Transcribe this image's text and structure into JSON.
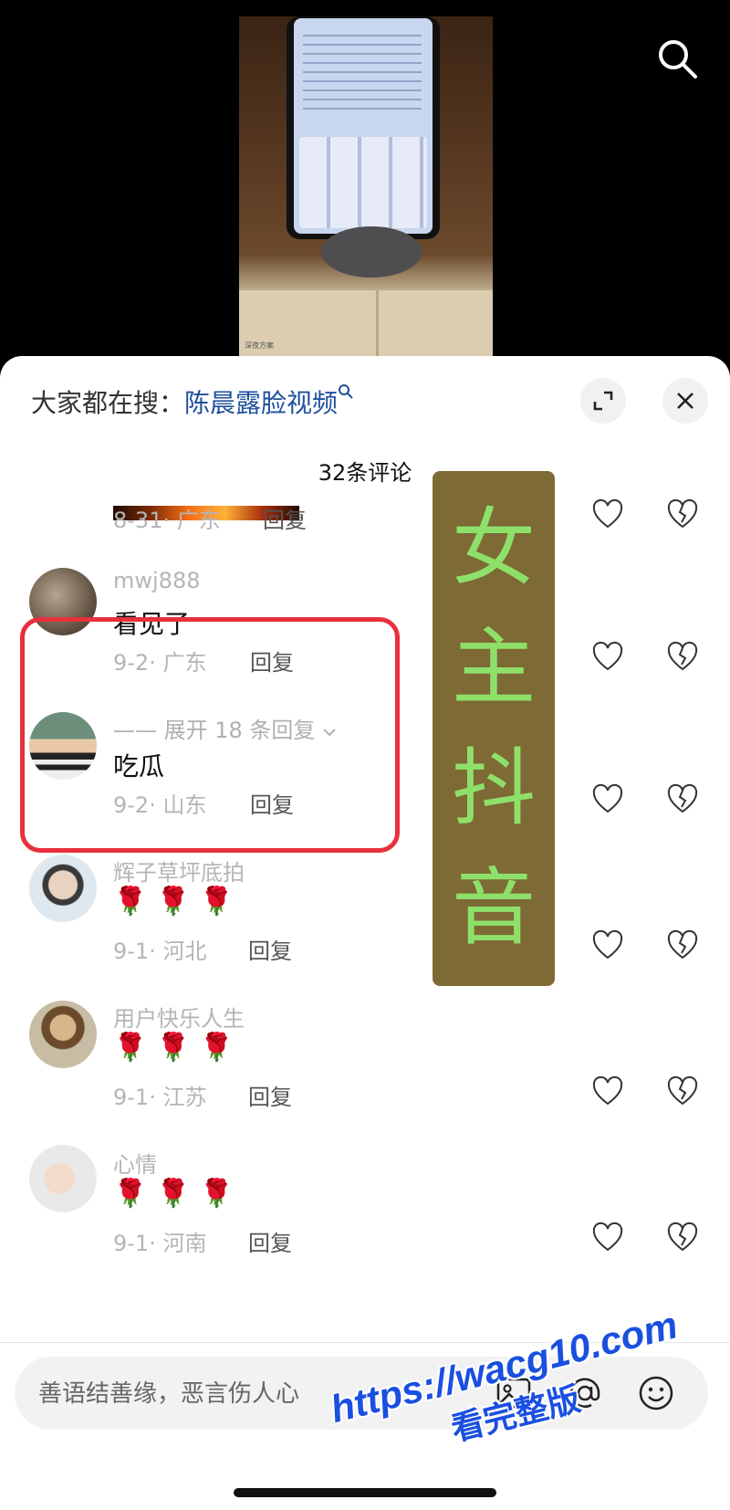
{
  "video": {
    "caption": "深夜方案"
  },
  "header": {
    "trending_prefix": "大家都在搜：",
    "trending_link": "陈晨露脸视频"
  },
  "comments_count": "32条评论",
  "comments": [
    {
      "user": "",
      "text": "",
      "date": "8-31",
      "location": "广东",
      "reply": "回复"
    },
    {
      "user": "mwj888",
      "text": "看见了",
      "date": "9-2",
      "location": "广东",
      "reply": "回复"
    },
    {
      "expand": "—— 展开 18 条回复",
      "text": "吃瓜",
      "date": "9-2",
      "location": "山东",
      "reply": "回复"
    },
    {
      "user": "辉子草坪底拍",
      "text": "🌹🌹🌹",
      "date": "9-1",
      "location": "河北",
      "reply": "回复"
    },
    {
      "user": "用户快乐人生",
      "text": "🌹🌹🌹",
      "date": "9-1",
      "location": "江苏",
      "reply": "回复"
    },
    {
      "user": "心情",
      "text": "🌹🌹🌹",
      "date": "9-1",
      "location": "河南",
      "reply": "回复"
    }
  ],
  "banner": {
    "chars": [
      "女",
      "主",
      "抖",
      "音"
    ]
  },
  "input": {
    "placeholder": "善语结善缘，恶言伤人心"
  },
  "watermark": {
    "url": "https://wacg10.com",
    "sub": "看完整版"
  },
  "icons": {
    "top_search": "search-icon",
    "expand": "expand-icon",
    "close": "close-icon",
    "like": "heart-outline-icon",
    "dislike": "broken-heart-icon",
    "image": "image-icon",
    "mention": "at-icon",
    "emoji": "emoji-icon"
  }
}
